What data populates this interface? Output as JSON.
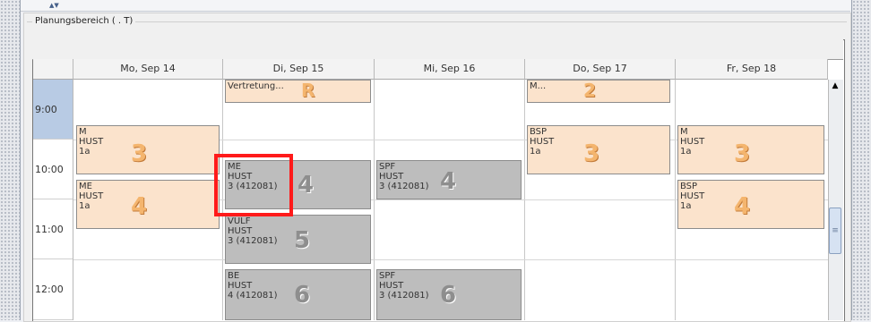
{
  "panel": {
    "legend": "Planungsbereich (              .         T)"
  },
  "days": [
    {
      "label": "Mo, Sep 14"
    },
    {
      "label": "Di, Sep 15"
    },
    {
      "label": "Mi, Sep 16"
    },
    {
      "label": "Do, Sep 17"
    },
    {
      "label": "Fr, Sep 18"
    }
  ],
  "times": [
    "9:00",
    "10:00",
    "11:00",
    "12:00"
  ],
  "events": {
    "di_vertretung": {
      "l1": "Vertretung...",
      "num": "R"
    },
    "do_m": {
      "l1": "M...",
      "num": "2"
    },
    "mo_m": {
      "l1": "M",
      "l2": "HUST",
      "l3": "1a",
      "num": "3"
    },
    "mo_me": {
      "l1": "ME",
      "l2": "HUST",
      "l3": "1a",
      "num": "4"
    },
    "di_me": {
      "l1": "ME",
      "l2": "HUST",
      "l3": "3 (412081)",
      "num": "4"
    },
    "di_vulf": {
      "l1": "VULF",
      "l2": "HUST",
      "l3": "3 (412081)",
      "num": "5"
    },
    "di_be": {
      "l1": "BE",
      "l2": "HUST",
      "l3": "4 (412081)",
      "num": "6"
    },
    "mi_spf1": {
      "l1": "SPF",
      "l2": "HUST",
      "l3": "3 (412081)",
      "num": "4"
    },
    "mi_spf2": {
      "l1": "SPF",
      "l2": "HUST",
      "l3": "3 (412081)",
      "num": "6"
    },
    "do_bsp": {
      "l1": "BSP",
      "l2": "HUST",
      "l3": "1a",
      "num": "3"
    },
    "fr_m": {
      "l1": "M",
      "l2": "HUST",
      "l3": "1a",
      "num": "3"
    },
    "fr_bsp": {
      "l1": "BSP",
      "l2": "HUST",
      "l3": "1a",
      "num": "4"
    }
  },
  "colors": {
    "peach": "#fbe3cc",
    "grey": "#bdbdbd",
    "selection": "#b8cbe4",
    "highlight": "#ff1a1a"
  }
}
